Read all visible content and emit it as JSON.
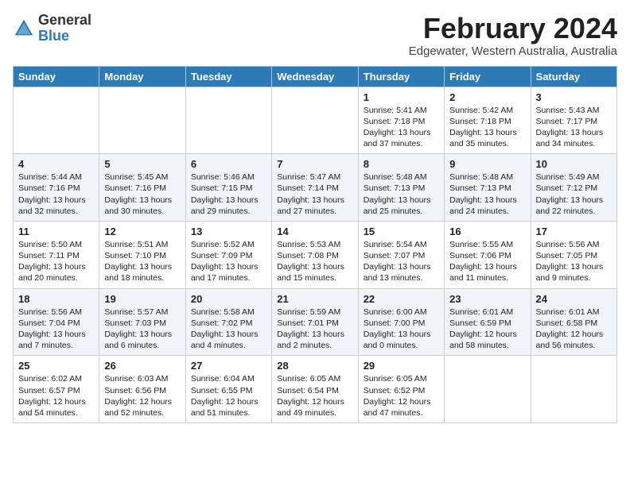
{
  "header": {
    "logo_line1": "General",
    "logo_line2": "Blue",
    "month_title": "February 2024",
    "subtitle": "Edgewater, Western Australia, Australia"
  },
  "days_of_week": [
    "Sunday",
    "Monday",
    "Tuesday",
    "Wednesday",
    "Thursday",
    "Friday",
    "Saturday"
  ],
  "weeks": [
    [
      {
        "day": "",
        "content": ""
      },
      {
        "day": "",
        "content": ""
      },
      {
        "day": "",
        "content": ""
      },
      {
        "day": "",
        "content": ""
      },
      {
        "day": "1",
        "content": "Sunrise: 5:41 AM\nSunset: 7:18 PM\nDaylight: 13 hours\nand 37 minutes."
      },
      {
        "day": "2",
        "content": "Sunrise: 5:42 AM\nSunset: 7:18 PM\nDaylight: 13 hours\nand 35 minutes."
      },
      {
        "day": "3",
        "content": "Sunrise: 5:43 AM\nSunset: 7:17 PM\nDaylight: 13 hours\nand 34 minutes."
      }
    ],
    [
      {
        "day": "4",
        "content": "Sunrise: 5:44 AM\nSunset: 7:16 PM\nDaylight: 13 hours\nand 32 minutes."
      },
      {
        "day": "5",
        "content": "Sunrise: 5:45 AM\nSunset: 7:16 PM\nDaylight: 13 hours\nand 30 minutes."
      },
      {
        "day": "6",
        "content": "Sunrise: 5:46 AM\nSunset: 7:15 PM\nDaylight: 13 hours\nand 29 minutes."
      },
      {
        "day": "7",
        "content": "Sunrise: 5:47 AM\nSunset: 7:14 PM\nDaylight: 13 hours\nand 27 minutes."
      },
      {
        "day": "8",
        "content": "Sunrise: 5:48 AM\nSunset: 7:13 PM\nDaylight: 13 hours\nand 25 minutes."
      },
      {
        "day": "9",
        "content": "Sunrise: 5:48 AM\nSunset: 7:13 PM\nDaylight: 13 hours\nand 24 minutes."
      },
      {
        "day": "10",
        "content": "Sunrise: 5:49 AM\nSunset: 7:12 PM\nDaylight: 13 hours\nand 22 minutes."
      }
    ],
    [
      {
        "day": "11",
        "content": "Sunrise: 5:50 AM\nSunset: 7:11 PM\nDaylight: 13 hours\nand 20 minutes."
      },
      {
        "day": "12",
        "content": "Sunrise: 5:51 AM\nSunset: 7:10 PM\nDaylight: 13 hours\nand 18 minutes."
      },
      {
        "day": "13",
        "content": "Sunrise: 5:52 AM\nSunset: 7:09 PM\nDaylight: 13 hours\nand 17 minutes."
      },
      {
        "day": "14",
        "content": "Sunrise: 5:53 AM\nSunset: 7:08 PM\nDaylight: 13 hours\nand 15 minutes."
      },
      {
        "day": "15",
        "content": "Sunrise: 5:54 AM\nSunset: 7:07 PM\nDaylight: 13 hours\nand 13 minutes."
      },
      {
        "day": "16",
        "content": "Sunrise: 5:55 AM\nSunset: 7:06 PM\nDaylight: 13 hours\nand 11 minutes."
      },
      {
        "day": "17",
        "content": "Sunrise: 5:56 AM\nSunset: 7:05 PM\nDaylight: 13 hours\nand 9 minutes."
      }
    ],
    [
      {
        "day": "18",
        "content": "Sunrise: 5:56 AM\nSunset: 7:04 PM\nDaylight: 13 hours\nand 7 minutes."
      },
      {
        "day": "19",
        "content": "Sunrise: 5:57 AM\nSunset: 7:03 PM\nDaylight: 13 hours\nand 6 minutes."
      },
      {
        "day": "20",
        "content": "Sunrise: 5:58 AM\nSunset: 7:02 PM\nDaylight: 13 hours\nand 4 minutes."
      },
      {
        "day": "21",
        "content": "Sunrise: 5:59 AM\nSunset: 7:01 PM\nDaylight: 13 hours\nand 2 minutes."
      },
      {
        "day": "22",
        "content": "Sunrise: 6:00 AM\nSunset: 7:00 PM\nDaylight: 13 hours\nand 0 minutes."
      },
      {
        "day": "23",
        "content": "Sunrise: 6:01 AM\nSunset: 6:59 PM\nDaylight: 12 hours\nand 58 minutes."
      },
      {
        "day": "24",
        "content": "Sunrise: 6:01 AM\nSunset: 6:58 PM\nDaylight: 12 hours\nand 56 minutes."
      }
    ],
    [
      {
        "day": "25",
        "content": "Sunrise: 6:02 AM\nSunset: 6:57 PM\nDaylight: 12 hours\nand 54 minutes."
      },
      {
        "day": "26",
        "content": "Sunrise: 6:03 AM\nSunset: 6:56 PM\nDaylight: 12 hours\nand 52 minutes."
      },
      {
        "day": "27",
        "content": "Sunrise: 6:04 AM\nSunset: 6:55 PM\nDaylight: 12 hours\nand 51 minutes."
      },
      {
        "day": "28",
        "content": "Sunrise: 6:05 AM\nSunset: 6:54 PM\nDaylight: 12 hours\nand 49 minutes."
      },
      {
        "day": "29",
        "content": "Sunrise: 6:05 AM\nSunset: 6:52 PM\nDaylight: 12 hours\nand 47 minutes."
      },
      {
        "day": "",
        "content": ""
      },
      {
        "day": "",
        "content": ""
      }
    ]
  ]
}
